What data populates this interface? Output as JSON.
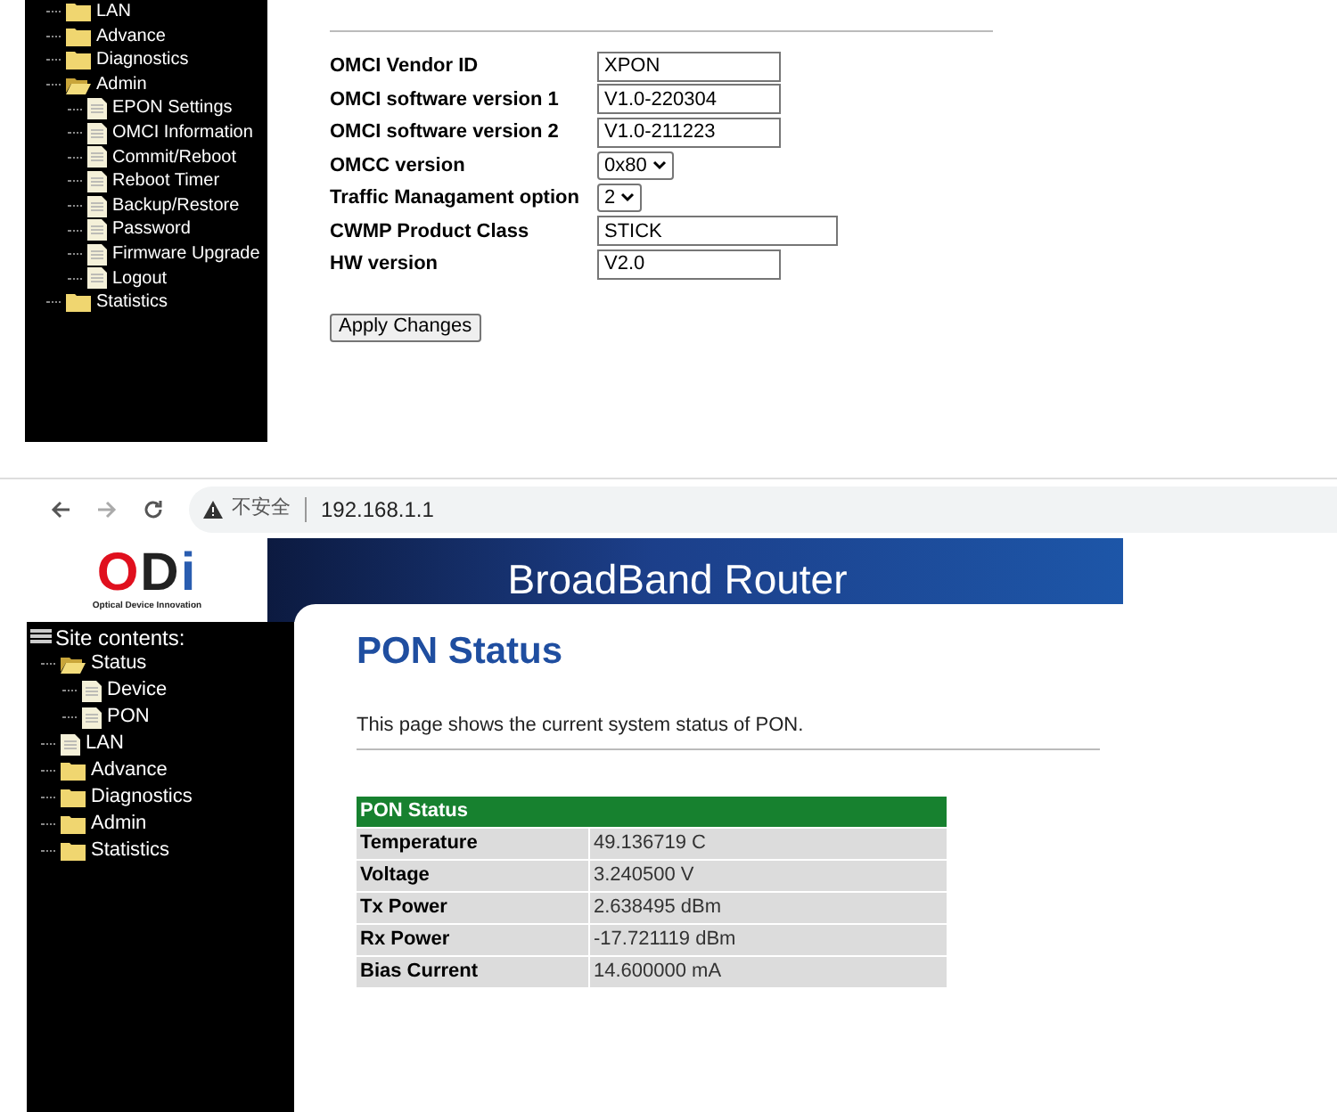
{
  "top_panel": {
    "sidebar": {
      "items": [
        {
          "label": "LAN",
          "kind": "folder",
          "expanded": false
        },
        {
          "label": "Advance",
          "kind": "folder",
          "expanded": false
        },
        {
          "label": "Diagnostics",
          "kind": "folder",
          "expanded": false
        },
        {
          "label": "Admin",
          "kind": "folder",
          "expanded": true,
          "children": [
            {
              "label": "EPON Settings",
              "kind": "page"
            },
            {
              "label": "OMCI Information",
              "kind": "page"
            },
            {
              "label": "Commit/Reboot",
              "kind": "page"
            },
            {
              "label": "Reboot Timer",
              "kind": "page"
            },
            {
              "label": "Backup/Restore",
              "kind": "page"
            },
            {
              "label": "Password",
              "kind": "page"
            },
            {
              "label": "Firmware Upgrade",
              "kind": "page"
            },
            {
              "label": "Logout",
              "kind": "page"
            }
          ]
        },
        {
          "label": "Statistics",
          "kind": "folder",
          "expanded": false
        }
      ]
    },
    "form": {
      "fields": [
        {
          "label": "OMCI Vendor ID",
          "kind": "text",
          "value": "XPON"
        },
        {
          "label": "OMCI software version 1",
          "kind": "text",
          "value": "V1.0-220304"
        },
        {
          "label": "OMCI software version 2",
          "kind": "text",
          "value": "V1.0-211223"
        },
        {
          "label": "OMCC version",
          "kind": "select",
          "value": "0x80"
        },
        {
          "label": "Traffic Managament option",
          "kind": "select",
          "value": "2"
        },
        {
          "label": "CWMP Product Class",
          "kind": "wide_text",
          "value": "STICK"
        },
        {
          "label": "HW version",
          "kind": "text",
          "value": "V2.0"
        }
      ],
      "button": "Apply Changes"
    }
  },
  "bottom_panel": {
    "browser": {
      "security": "不安全",
      "url": "192.168.1.1"
    },
    "header": {
      "logo_letters": "ODi",
      "logo_tagline": "Optical Device Innovation",
      "title": "BroadBand Router"
    },
    "sidebar": {
      "title": "Site contents:",
      "items": [
        {
          "label": "Status",
          "kind": "folder",
          "expanded": true,
          "children": [
            {
              "label": "Device",
              "kind": "page"
            },
            {
              "label": "PON",
              "kind": "page"
            }
          ]
        },
        {
          "label": "LAN",
          "kind": "page"
        },
        {
          "label": "Advance",
          "kind": "folder",
          "expanded": false
        },
        {
          "label": "Diagnostics",
          "kind": "folder",
          "expanded": false
        },
        {
          "label": "Admin",
          "kind": "folder",
          "expanded": false
        },
        {
          "label": "Statistics",
          "kind": "folder",
          "expanded": false
        }
      ]
    },
    "page": {
      "title": "PON Status",
      "description": "This page shows the current system status of PON.",
      "table": {
        "heading": "PON Status",
        "rows": [
          {
            "label": "Temperature",
            "value": "49.136719 C"
          },
          {
            "label": "Voltage",
            "value": "3.240500 V"
          },
          {
            "label": "Tx Power",
            "value": "2.638495 dBm"
          },
          {
            "label": "Rx Power",
            "value": "-17.721119 dBm"
          },
          {
            "label": "Bias Current",
            "value": "14.600000 mA"
          }
        ]
      }
    }
  }
}
